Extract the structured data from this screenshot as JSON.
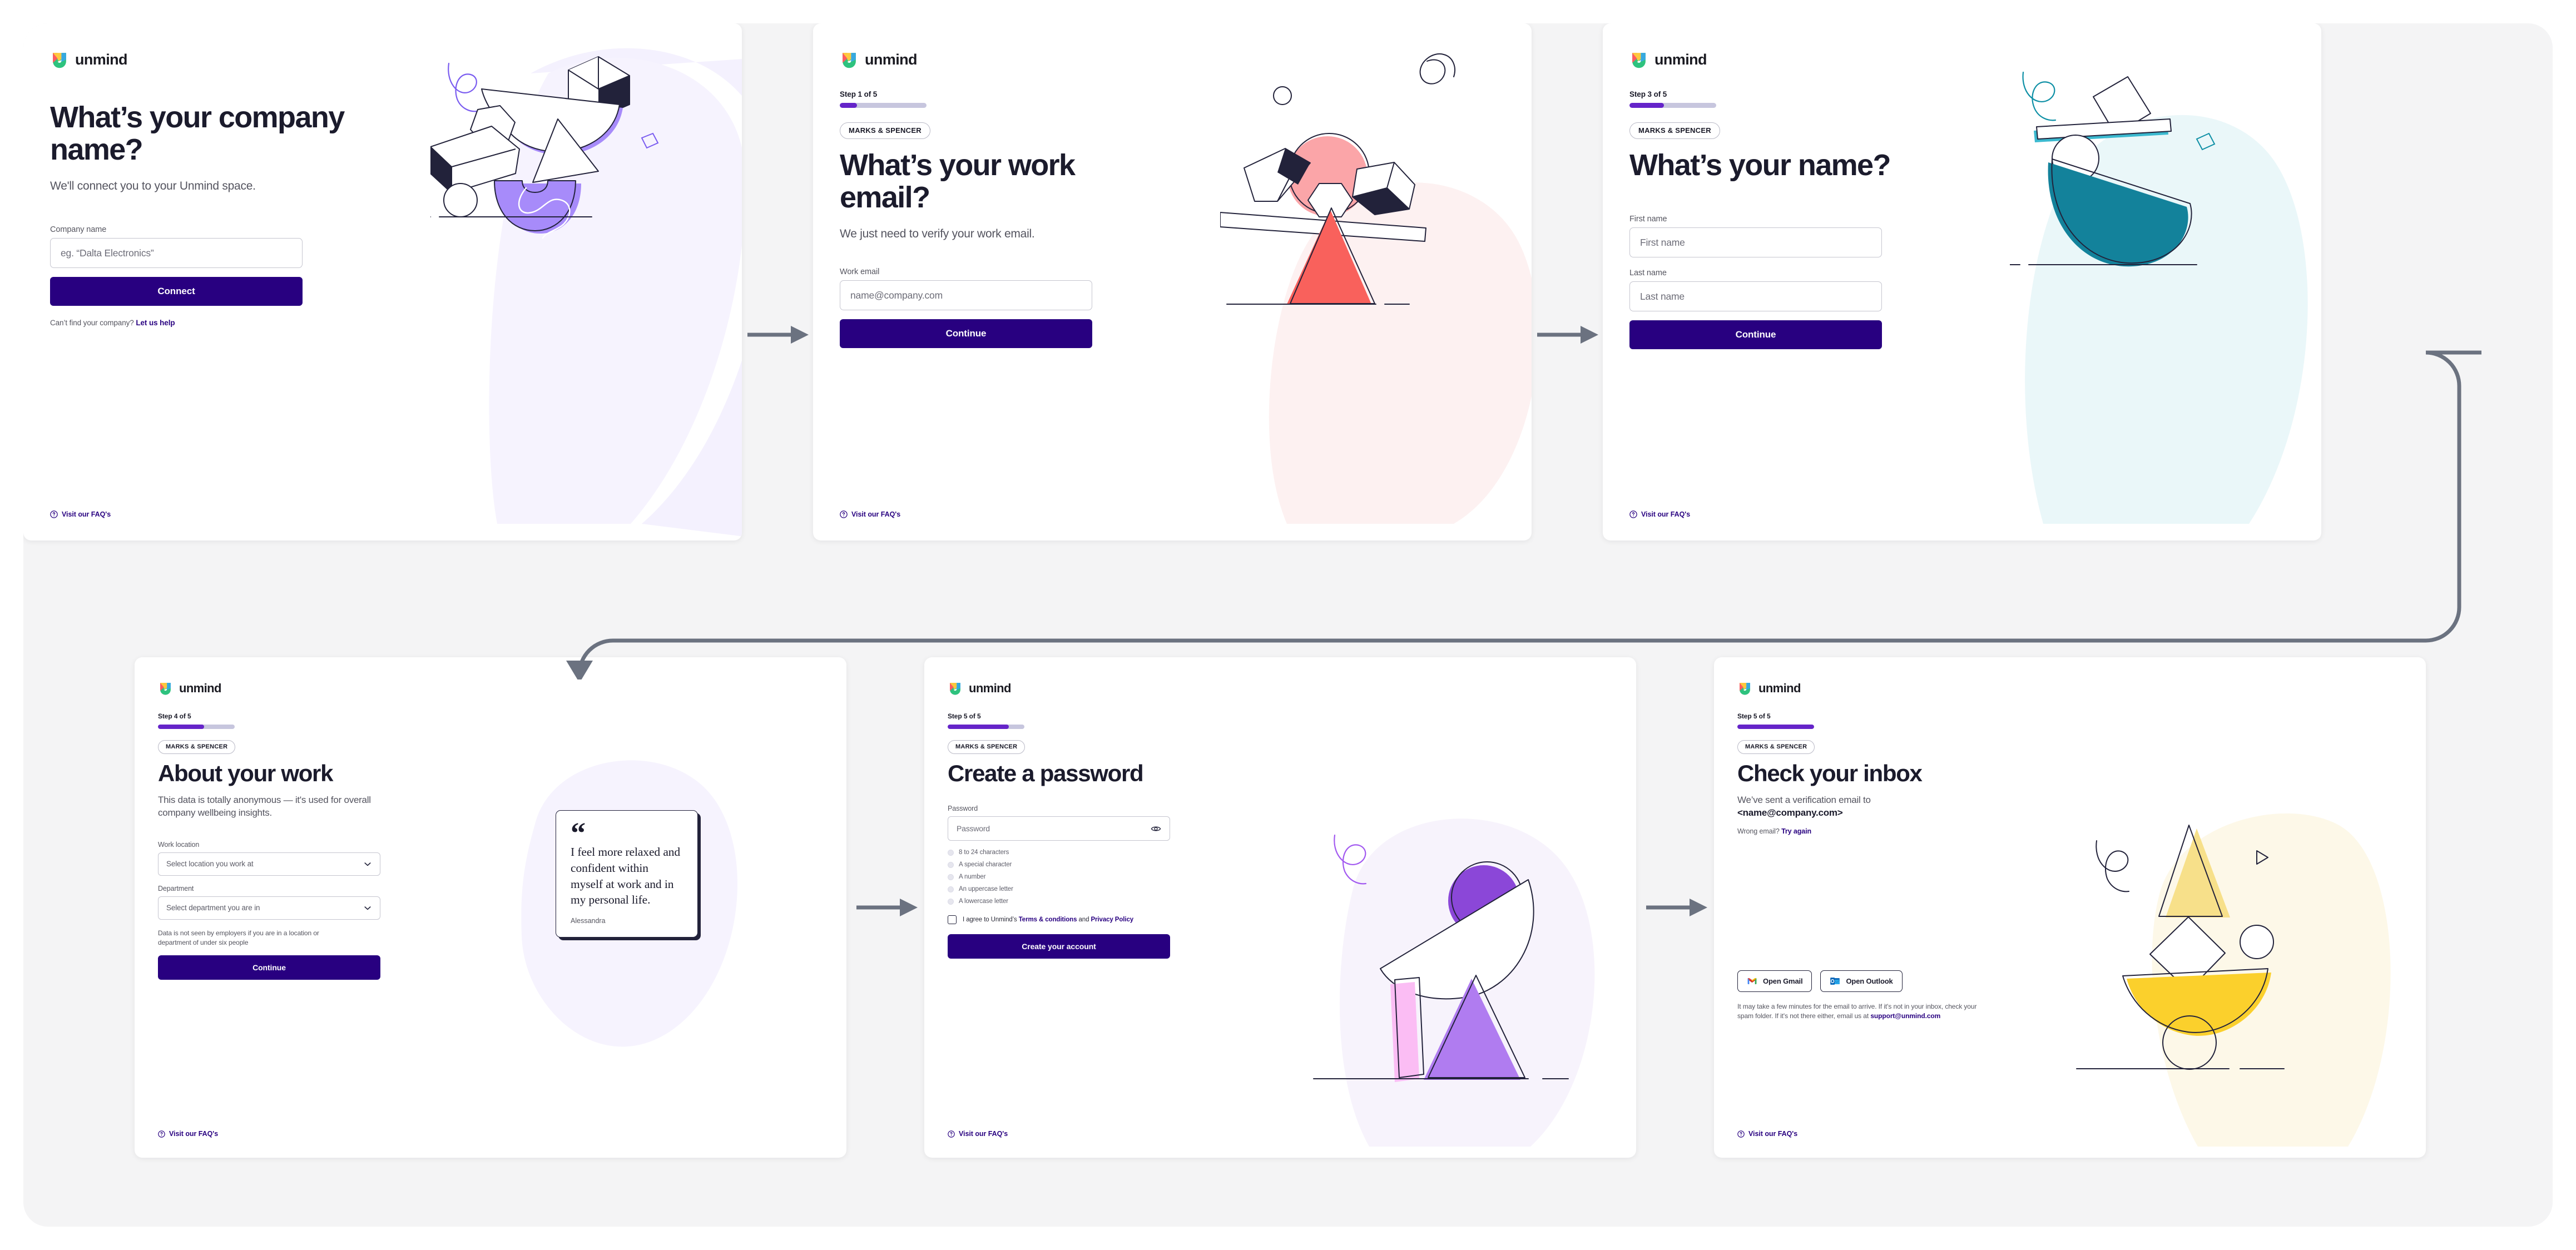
{
  "brand": {
    "name": "unmind",
    "primary": "#280080",
    "progress_accent": "#6524c9",
    "link": "#280080"
  },
  "common": {
    "faq_label": "Visit our FAQ's",
    "company_pill": "MARKS & SPENCER"
  },
  "cards": [
    {
      "id": "company-name",
      "logo": "unmind",
      "title": "What’s your company name?",
      "subtitle": "We'll connect you to your Unmind space.",
      "field_label": "Company name",
      "field_placeholder": "eg. “Dalta Electronics”",
      "button": "Connect",
      "helper_text": "Can’t find your company?",
      "helper_link": "Let us help",
      "faq": "Visit our FAQ's"
    },
    {
      "id": "work-email",
      "logo": "unmind",
      "step": "Step 1 of 5",
      "progress_pct": 20,
      "pill": "MARKS & SPENCER",
      "title": "What’s your work email?",
      "subtitle": "We just need to verify your work email.",
      "field_label": "Work email",
      "field_placeholder": "name@company.com",
      "button": "Continue",
      "faq": "Visit our FAQ's"
    },
    {
      "id": "your-name",
      "logo": "unmind",
      "step": "Step 3 of 5",
      "progress_pct": 40,
      "pill": "MARKS & SPENCER",
      "title": "What’s your name?",
      "first_name_label": "First name",
      "first_name_placeholder": "First name",
      "last_name_label": "Last name",
      "last_name_placeholder": "Last name",
      "button": "Continue",
      "faq": "Visit our FAQ's"
    },
    {
      "id": "about-your-work",
      "logo": "unmind",
      "step": "Step 4 of 5",
      "progress_pct": 60,
      "pill": "MARKS & SPENCER",
      "title": "About your work",
      "subtitle": "This data is totally anonymous — it's used for overall company wellbeing insights.",
      "location_label": "Work location",
      "location_placeholder": "Select location you work at",
      "department_label": "Department",
      "department_placeholder": "Select department you are in",
      "note": "Data is not seen by employers if you are in a location or department of under six people",
      "button": "Continue",
      "faq": "Visit our FAQ's",
      "quote": {
        "mark": "“",
        "text": "I feel more relaxed and confident within myself at work and in my personal life.",
        "author": "Alessandra"
      }
    },
    {
      "id": "create-password",
      "logo": "unmind",
      "step": "Step 5 of 5",
      "progress_pct": 80,
      "pill": "MARKS & SPENCER",
      "title": "Create a password",
      "field_label": "Password",
      "field_placeholder": "Password",
      "reveal_icon": "eye-icon",
      "requirements": [
        "8 to 24 characters",
        "A special character",
        "A number",
        "An uppercase letter",
        "A lowercase letter"
      ],
      "agree_prefix": "I agree to Unmind’s ",
      "agree_terms": "Terms & conditions",
      "agree_and": " and ",
      "agree_privacy": "Privacy Policy",
      "button": "Create your account",
      "faq": "Visit our FAQ's"
    },
    {
      "id": "check-inbox",
      "logo": "unmind",
      "step": "Step 5 of 5",
      "progress_pct": 100,
      "pill": "MARKS & SPENCER",
      "title": "Check your inbox",
      "subtitle_line1": "We’ve sent a verification email to",
      "subtitle_email": "<name@company.com>",
      "wrong_email_text": "Wrong email?",
      "wrong_email_link": "Try again",
      "gmail_button": "Open Gmail",
      "outlook_button": "Open Outlook",
      "note_text": "It may take a few minutes for the email to arrive. If it's not in your inbox, check your spam folder. If it's not there either, email us at ",
      "note_email": "support@unmind.com",
      "faq": "Visit our FAQ's"
    }
  ],
  "connectors": {
    "arrow_color": "#6b7280",
    "arrows": [
      "card1-to-card2",
      "card2-to-card3",
      "card3-to-card4-wrap",
      "card4-to-card5",
      "card5-to-card6"
    ]
  }
}
